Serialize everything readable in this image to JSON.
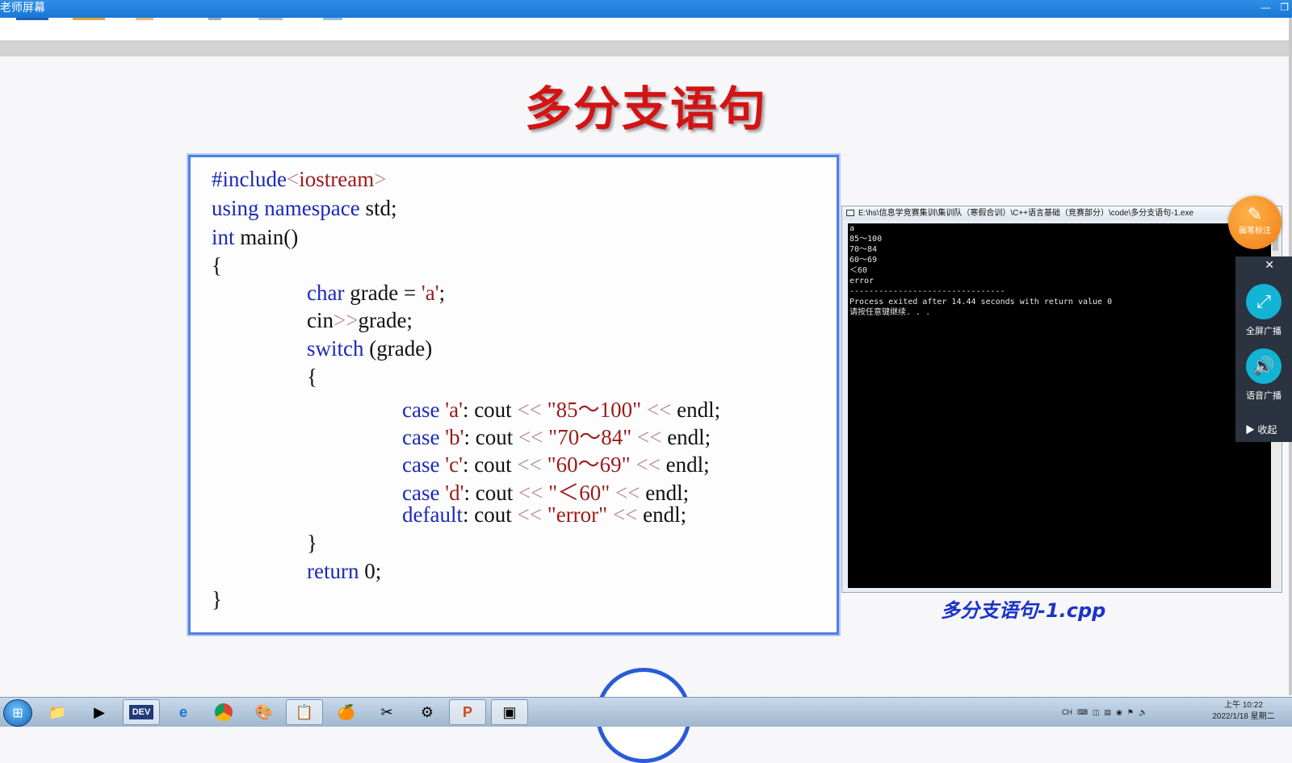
{
  "window": {
    "title": "老师屏幕",
    "minimize_glyph": "—",
    "restore_glyph": "❐"
  },
  "slide": {
    "title": "多分支语句",
    "caption": "多分支语句-1.cpp",
    "code_lines": [
      "#include<iostream>",
      "using namespace std;",
      "int main()",
      "{",
      "char grade = 'a';",
      "cin>>grade;",
      "switch (grade)",
      "{",
      "case 'a': cout << \"85～100\" << endl;",
      "case 'b': cout << \"70～84\" << endl;",
      "case 'c': cout << \"60～69\" << endl;",
      "case 'd': cout << \"＜60\" << endl;",
      "default: cout << \"error\" << endl;",
      "}",
      "return 0;",
      "}"
    ]
  },
  "console": {
    "title": "E:\\hs\\信息学竞赛集训\\集训队（寒假合训）\\C++语言基础（竞赛部分）\\code\\多分支语句-1.exe",
    "output_lines": [
      "a",
      "85～100",
      "70～84",
      "60～69",
      "＜60",
      "error",
      "",
      "--------------------------------",
      "Process exited after 14.44 seconds with return value 0",
      "请按任意键继续. . ."
    ]
  },
  "side_tools": {
    "pen_label": "画笔标注",
    "close_glyph": "✕",
    "fullscreen_label": "全屏广播",
    "voice_label": "语音广播",
    "collapse_label": "▶  收起"
  },
  "taskbar": {
    "apps": [
      "file-explorer-icon",
      "media-player-icon",
      "dev-cpp-icon",
      "ie-icon",
      "chrome-icon",
      "app-icon",
      "app-icon",
      "orange-icon",
      "tool-icon",
      "network-icon",
      "powerpoint-icon",
      "window-icon"
    ],
    "tray_lang": "CH",
    "clock_time": "上午 10:22",
    "clock_date": "2022/1/18 星期二"
  },
  "colors": {
    "title_red": "#d21414",
    "keyword_blue": "#1b2ab8",
    "string_red": "#9b1a1a",
    "code_border": "#4f7fe6",
    "caption_blue": "#1a33c9",
    "pen_orange": "#f07d14",
    "panel_dark": "#2b3340",
    "accent_cyan": "#12b3d3"
  }
}
